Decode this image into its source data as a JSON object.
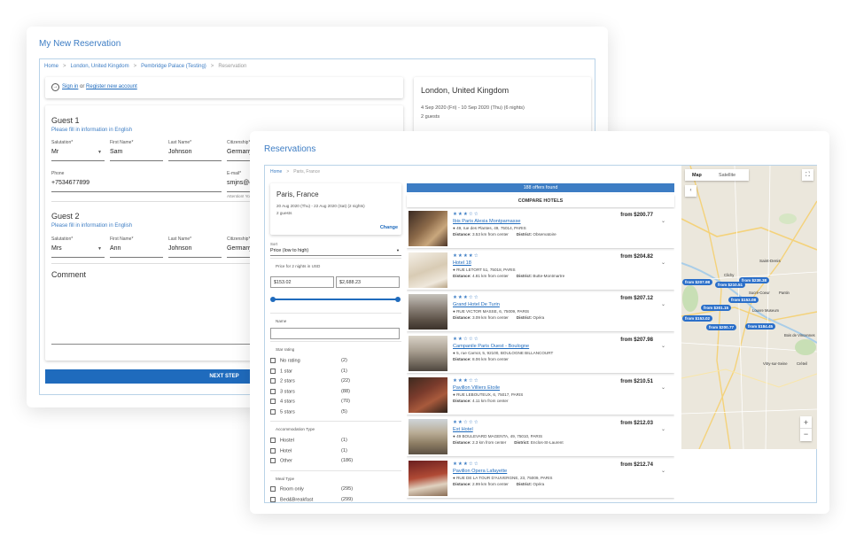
{
  "back": {
    "title": "My New Reservation",
    "breadcrumb": [
      "Home",
      "London, United Kingdom",
      "Pembridge Palace (Testing)",
      "Reservation"
    ],
    "sign_in": "Sign in",
    "or_text": "or",
    "register": "Register new account",
    "summary": {
      "city": "London, United Kingdom",
      "dates": "4 Sep 2020 (Fri) - 10 Sep 2020 (Thu) (6 nights)",
      "guests": "2 guests"
    },
    "guest1": {
      "heading": "Guest 1",
      "note": "Please fill in information in English",
      "salutation_label": "Salutation*",
      "salutation": "Mr",
      "first_label": "First Name*",
      "first": "Sam",
      "last_label": "Last Name*",
      "last": "Johnson",
      "citizenship_label": "Citizenship*",
      "citizenship": "Germany",
      "phone_label": "Phone",
      "phone": "+7534677899",
      "email_label": "E-mail*",
      "email": "smjns@g",
      "attention": "Attention! Yo"
    },
    "guest2": {
      "heading": "Guest 2",
      "note": "Please fill in information in English",
      "salutation_label": "Salutation*",
      "salutation": "Mrs",
      "first_label": "First Name*",
      "first": "Ann",
      "last_label": "Last Name*",
      "last": "Johnson",
      "citizenship_label": "Citizenship*",
      "citizenship": "Germany"
    },
    "comment_heading": "Comment",
    "next_step": "NEXT STEP"
  },
  "front": {
    "title": "Reservations",
    "breadcrumb": [
      "Home",
      "Paris, France"
    ],
    "summary": {
      "city": "Paris, France",
      "dates": "20 Aug 2020 (Thu) - 22 Aug 2020 (Sat) (2 nights)",
      "guests": "2 guests",
      "change": "Change"
    },
    "sort_label": "Sort",
    "sort_value": "Price (low to high)",
    "price_label": "Price for 2 nights in USD",
    "price_min": "$153.02",
    "price_max": "$2,688.23",
    "name_label": "Name",
    "star_heading": "Star rating",
    "star_filters": [
      {
        "label": "No rating",
        "count": "(2)"
      },
      {
        "label": "1 star",
        "count": "(1)"
      },
      {
        "label": "2 stars",
        "count": "(22)"
      },
      {
        "label": "3 stars",
        "count": "(88)"
      },
      {
        "label": "4 stars",
        "count": "(70)"
      },
      {
        "label": "5 stars",
        "count": "(5)"
      }
    ],
    "acc_heading": "Accommodation Type",
    "acc_filters": [
      {
        "label": "Hostel",
        "count": "(1)"
      },
      {
        "label": "Hotel",
        "count": "(1)"
      },
      {
        "label": "Other",
        "count": "(186)"
      }
    ],
    "meal_heading": "Meal Type",
    "meal_filters": [
      {
        "label": "Room only",
        "count": "(295)"
      },
      {
        "label": "Bed&Breakfast",
        "count": "(299)"
      }
    ],
    "offers_found": "188 offers found",
    "compare": "COMPARE HOTELS",
    "hotels": [
      {
        "stars": "★★★☆☆",
        "name": "Ibis Paris Alesia Montparnasse",
        "address": "49, rue des Plantes, 49, 75014, PARIS",
        "distance_label": "Distance:",
        "distance": "3.53 km from center",
        "district_label": "District:",
        "district": "Observatoire",
        "price": "from $200.77"
      },
      {
        "stars": "★★★★☆",
        "name": "Hotel 18",
        "address": "RUE LETORT 51, 75018, PARIS",
        "distance_label": "Distance:",
        "distance": "4.81 km from center",
        "district_label": "District:",
        "district": "Butte-Montmartre",
        "price": "from $204.82"
      },
      {
        "stars": "★★★☆☆",
        "name": "Grand Hotel De Turin",
        "address": "RUE VICTOR MASSE, 6, 75009, PARIS",
        "distance_label": "Distance:",
        "distance": "3.09 km from center",
        "district_label": "District:",
        "district": "Opéra",
        "price": "from $207.12"
      },
      {
        "stars": "★★☆☆☆",
        "name": "Campanile Paris Ouest - Boulogne",
        "address": "5, rue Carnot, 5, 92100, BOULOGNE BILLANCOURT",
        "distance_label": "Distance:",
        "distance": "8.06 km from center",
        "district_label": "",
        "district": "",
        "price": "from $207.98"
      },
      {
        "stars": "★★★☆☆",
        "name": "Pavillon Villiers Etoile",
        "address": "RUE LEBOUTEUX, 6, 75017, PARIS",
        "distance_label": "Distance:",
        "distance": "4.11 km from center",
        "district_label": "",
        "district": "",
        "price": "from $210.51"
      },
      {
        "stars": "★★☆☆☆",
        "name": "Est Hotel",
        "address": "49 BOULEVARD MAGENTA, 49, 75010, PARIS",
        "distance_label": "Distance:",
        "distance": "2.3 km from center",
        "district_label": "District:",
        "district": "Enclos-St-Laurent",
        "price": "from $212.03"
      },
      {
        "stars": "★★★☆☆",
        "name": "Pavillon Opera Lafayette",
        "address": "RUE DE LA TOUR D'AUVERGNE, 23, 75009, PARIS",
        "distance_label": "Distance:",
        "distance": "2.99 km from center",
        "district_label": "District:",
        "district": "Opéra",
        "price": "from $212.74"
      }
    ],
    "map": {
      "tab_map": "Map",
      "tab_satellite": "Satellite",
      "zoom_in": "+",
      "zoom_out": "−",
      "markers": [
        "from $207.98",
        "from $210.51",
        "from $238.38",
        "from $153.08",
        "from $301.15",
        "from $153.02",
        "from $200.77",
        "from $184.45"
      ],
      "places": [
        "Saint-Denis",
        "Sucré-Coeur",
        "Louvre Museum",
        "Bois de Vincennes",
        "Vitry-sur-Seine",
        "Créteil",
        "Clichy",
        "Pantin"
      ]
    }
  }
}
